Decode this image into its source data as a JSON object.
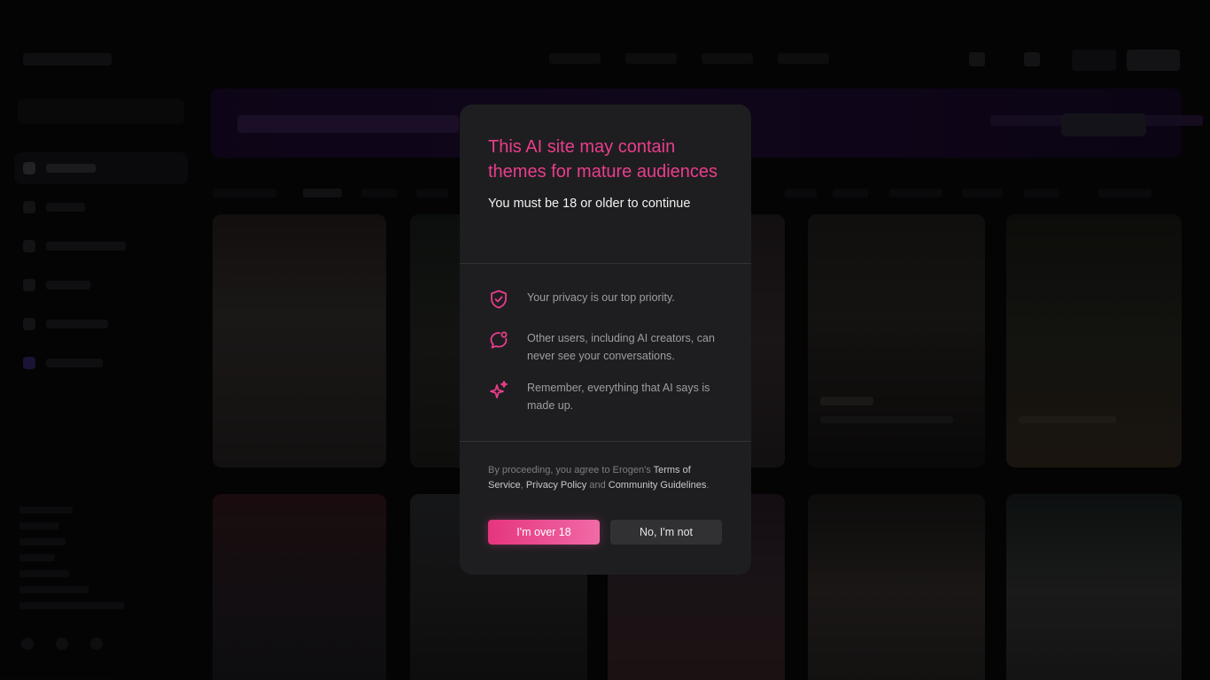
{
  "modal": {
    "title": "This AI site may contain themes for mature audiences",
    "subtitle": "You must be 18 or older to continue",
    "features": [
      {
        "icon": "shield-check-icon",
        "text": "Your privacy is our top priority."
      },
      {
        "icon": "chat-notification-icon",
        "text": "Other users, including AI creators, can never see your conversations."
      },
      {
        "icon": "sparkles-icon",
        "text": "Remember, everything that AI says is made up."
      }
    ],
    "legal": {
      "prefix": "By proceeding, you agree to Erogen's ",
      "terms": "Terms of Service",
      "sep1": ", ",
      "privacy": "Privacy Policy",
      "sep2": " and ",
      "guidelines": "Community Guidelines",
      "suffix": "."
    },
    "accept_label": "I'm over 18",
    "decline_label": "No, I'm not"
  },
  "colors": {
    "accent": "#ea3d8b",
    "accent_gradient_end": "#f06aa6",
    "modal_bg": "#1e1e20",
    "overlay": "rgba(0,0,0,0.55)"
  }
}
